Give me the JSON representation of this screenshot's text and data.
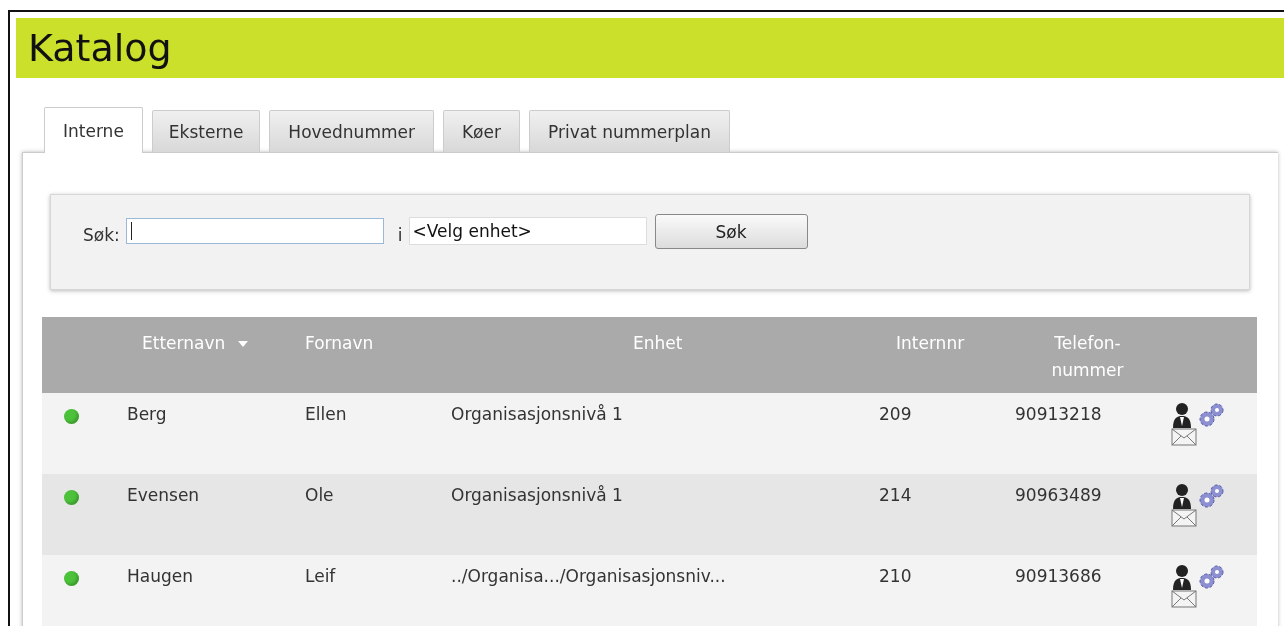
{
  "title": "Katalog",
  "tabs": [
    {
      "label": "Interne",
      "selected": true
    },
    {
      "label": "Eksterne",
      "selected": false
    },
    {
      "label": "Hovednummer",
      "selected": false
    },
    {
      "label": "Køer",
      "selected": false
    },
    {
      "label": "Privat nummerplan",
      "selected": false
    }
  ],
  "search": {
    "label": "Søk:",
    "connector": "i",
    "unit_value": "<Velg enhet>",
    "button": "Søk"
  },
  "table": {
    "columns": [
      {
        "label": "Etternavn",
        "sorted": true
      },
      {
        "label": "Fornavn",
        "sorted": false
      },
      {
        "label": "Enhet",
        "sorted": false
      },
      {
        "label": "Internnr",
        "sorted": false
      },
      {
        "label": "Telefon-nummer",
        "sorted": false
      }
    ],
    "rows": [
      {
        "color": "#4cc23a",
        "last_name": "Berg",
        "first_name": "Ellen",
        "unit": "Organisasjonsnivå 1",
        "internal": "209",
        "phone": "90913218"
      },
      {
        "color": "#4cc23a",
        "last_name": "Evensen",
        "first_name": "Ole",
        "unit": "Organisasjonsnivå 1",
        "internal": "214",
        "phone": "90963489"
      },
      {
        "color": "#4cc23a",
        "last_name": "Haugen",
        "first_name": "Leif",
        "unit": "../Organisa.../Organisasjonsniv...",
        "internal": "210",
        "phone": "90913686"
      }
    ]
  }
}
